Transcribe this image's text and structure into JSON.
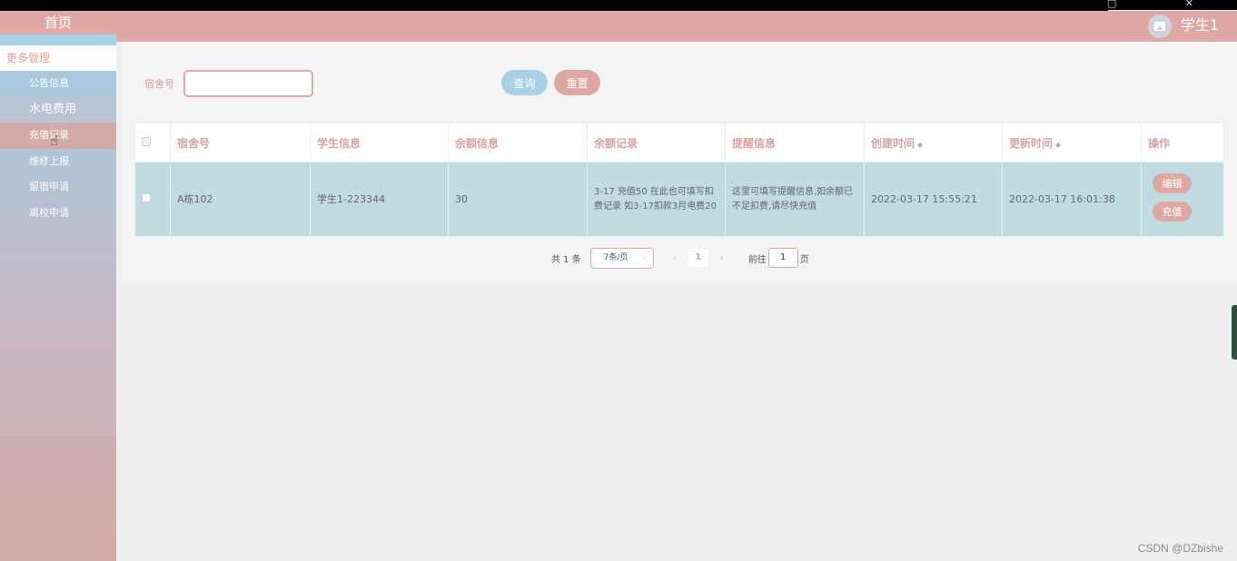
{
  "window": {
    "controls": "□ ✕"
  },
  "sidebar": {
    "home": "首页",
    "more": "更多管理",
    "items": [
      {
        "label": "公告信息"
      },
      {
        "label": "水电费用"
      },
      {
        "label": "充值记录"
      },
      {
        "label": "维修上报"
      },
      {
        "label": "留宿申请"
      },
      {
        "label": "离校申请"
      }
    ]
  },
  "header": {
    "username": "学生1",
    "avatar_icon": "image-icon"
  },
  "search": {
    "label": "宿舍号",
    "value": "",
    "query_label": "查询",
    "reset_label": "重置"
  },
  "table": {
    "headers": {
      "room": "宿舍号",
      "student": "学生信息",
      "balance": "余额信息",
      "records": "余额记录",
      "reminder": "提醒信息",
      "created": "创建时间",
      "updated": "更新时间",
      "actions": "操作"
    },
    "rows": [
      {
        "room": "A栋102",
        "student": "学生1-223344",
        "balance": "30",
        "records": "3-17 充值50 在此也可填写扣费记录 如3-17扣款3月电费20",
        "reminder": "这里可填写提醒信息,如余额已不足扣费,请尽快充值",
        "created": "2022-03-17 15:55:21",
        "updated": "2022-03-17 16:01:38",
        "edit_label": "编辑",
        "recharge_label": "充值"
      }
    ]
  },
  "pagination": {
    "total": "共 1 条",
    "page_size": "7条/页",
    "prev": "‹",
    "current": "1",
    "next": "›",
    "goto_prefix": "前往",
    "goto_value": "1",
    "goto_suffix": "页"
  },
  "watermark": "CSDN @DZbishe"
}
